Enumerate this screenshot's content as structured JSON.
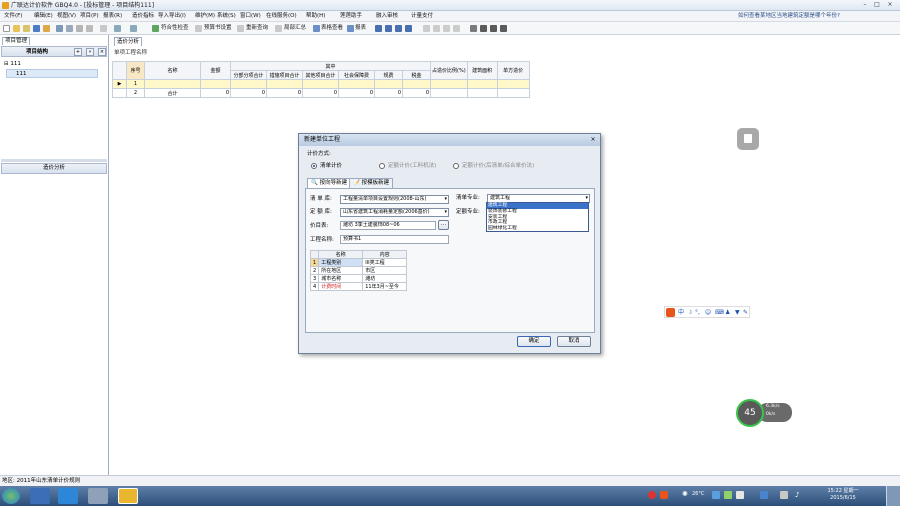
{
  "window": {
    "title": "广联达计价软件 GBQ4.0 - [投标管理 - 项目结构111]",
    "controls": [
      "–",
      "□",
      "×"
    ]
  },
  "menu": {
    "items": [
      "文件(F)",
      "编辑(E)",
      "视图(V)",
      "项目(P)",
      "报表(R)",
      "造价指标",
      "导入导出(I)",
      "维护(M)",
      "系统(S)",
      "窗口(W)",
      "在线服务(O)",
      "帮助(H)",
      "莲莲助手",
      "融入审核",
      "计量支付"
    ],
    "notice": "如何查看某地区当地建筑定额是哪个年份?"
  },
  "toolbar": {
    "labels": [
      "符合性检查",
      "预算书设置",
      "重新查询",
      "局部汇总",
      "表格查看",
      "报表"
    ]
  },
  "leftpanel": {
    "tab": "项目管理",
    "header": "项目结构",
    "tree": [
      "111",
      "111"
    ],
    "cost_tab": "造价分析"
  },
  "main": {
    "tab": "造价分析",
    "subtab": "单项工程名称",
    "grid": {
      "group_header": "其中",
      "headers": [
        "序号",
        "名称",
        "金额",
        "分部分项合计",
        "措施项目合计",
        "其他项目合计",
        "社会保障费",
        "规费",
        "税金",
        "占造价比例(%)",
        "建筑面积",
        "单方造价"
      ],
      "rows": [
        {
          "no": "1",
          "name": "",
          "vals": [
            "",
            "",
            "",
            "",
            "",
            "",
            "",
            "",
            "",
            ""
          ]
        },
        {
          "no": "2",
          "name": "合计",
          "vals": [
            "0",
            "0",
            "0",
            "0",
            "0",
            "0",
            "0",
            "",
            "",
            ""
          ]
        }
      ]
    }
  },
  "dialog": {
    "title": "新建单位工程",
    "close": "×",
    "calc_label": "计价方式:",
    "calc_options": [
      "清单计价",
      "定额计价(工料机法)",
      "定额计价(后清单/综合单价法)"
    ],
    "tabs": [
      "按向导新建",
      "按模板新建"
    ],
    "bill_lib_label": "清 单 库:",
    "bill_lib_value": "工程量清单项目设置规则(2008-山东)",
    "quota_lib_label": "定 额 库:",
    "quota_lib_value": "山东省建筑工程消耗量定额(2006基价)",
    "major_label": "清单专业:",
    "major_value": "建筑工程",
    "quota_major_label": "定额专业:",
    "price_file_label": "价目表:",
    "price_file_value": "潍坊 3季土建装饰08~06",
    "browse": "...",
    "project_name_label": "工程名称:",
    "project_name_value": "预算书1",
    "dropdown_options": [
      "建筑工程",
      "装饰装修工程",
      "安装工程",
      "市政工程",
      "园林绿化工程"
    ],
    "props": {
      "headers": [
        "名称",
        "内容"
      ],
      "rows": [
        {
          "no": "1",
          "name": "工程类别",
          "value": "III类工程"
        },
        {
          "no": "2",
          "name": "所在地区",
          "value": "市区"
        },
        {
          "no": "3",
          "name": "城市名称",
          "value": "潍坊"
        },
        {
          "no": "4",
          "name": "计费时间",
          "value": "11年3月~至今"
        }
      ]
    },
    "ok": "确定",
    "cancel": "取消"
  },
  "statusbar": {
    "text": "地区: 2011年山东清单计价规则"
  },
  "taskbar": {
    "clock": "15:22 星期一",
    "date": "2015/6/15",
    "temp": "26°C"
  },
  "speed_widget": {
    "value": "45",
    "up": "6.3k/s",
    "down": "0k/s"
  },
  "colors": {
    "accent": "#3b73c9",
    "red_text": "#d02020"
  }
}
